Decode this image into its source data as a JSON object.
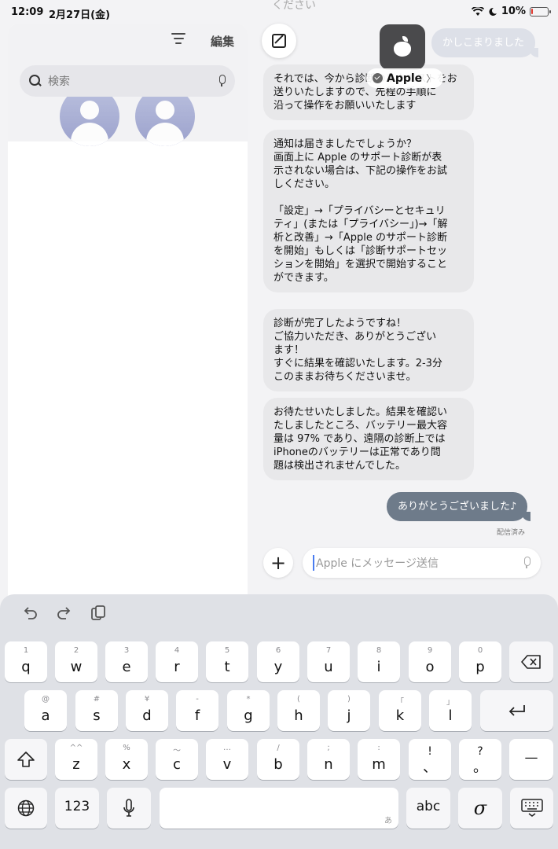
{
  "status_bar": {
    "time": "12:09",
    "date": "2月27日(金)",
    "battery": "10%",
    "battery_level_percent": 10,
    "icons": [
      "wifi-icon",
      "moon-icon",
      "battery-icon"
    ]
  },
  "sidebar": {
    "edit_label": "編集",
    "search_placeholder": "検索"
  },
  "conversation": {
    "contact_name": "Apple",
    "top_faded_text": "ください",
    "messages": [
      {
        "direction": "out",
        "text": "かしこまりました"
      },
      {
        "direction": "in",
        "text": "それでは、今から診断のリクエストをお\n送りいたしますので、先程の手順に\n沿って操作をお願いいたします"
      },
      {
        "direction": "in",
        "text": "通知は届きましたでしょうか？\n画面上に Apple のサポート診断が表\n示されない場合は、下記の操作をお試\nしください。\n\n「設定」→「プライバシーとセキュリ\nティ」(または「プライバシー」)→「解\n析と改善」→「Apple のサポート診断\nを開始」もしくは「診断サポートセッ\nションを開始」を選択で開始すること\nができます。"
      },
      {
        "direction": "in",
        "text": "診断が完了したようですね！\nご協力いただき、ありがとうござい\nます！\nすぐに結果を確認いたします。2-3分\nこのままお待ちくださいませ。"
      },
      {
        "direction": "in",
        "text": "お待たせいたしました。結果を確認い\nたしましたところ、バッテリー最大容\n量は 97% であり、遠隔の診断上では\niPhoneのバッテリーは正常であり問\n題は検出されませんでした。"
      },
      {
        "direction": "out",
        "text": "ありがとうございました♪"
      }
    ],
    "read_receipt": "配信済み",
    "composer_placeholder": "Apple にメッセージ送信"
  },
  "keyboard": {
    "row1": [
      {
        "sub": "1",
        "main": "q"
      },
      {
        "sub": "2",
        "main": "w"
      },
      {
        "sub": "3",
        "main": "e"
      },
      {
        "sub": "4",
        "main": "r"
      },
      {
        "sub": "5",
        "main": "t"
      },
      {
        "sub": "6",
        "main": "y"
      },
      {
        "sub": "7",
        "main": "u"
      },
      {
        "sub": "8",
        "main": "i"
      },
      {
        "sub": "9",
        "main": "o"
      },
      {
        "sub": "0",
        "main": "p"
      }
    ],
    "row2": [
      {
        "sub": "@",
        "main": "a"
      },
      {
        "sub": "#",
        "main": "s"
      },
      {
        "sub": "¥",
        "main": "d"
      },
      {
        "sub": "-",
        "main": "f"
      },
      {
        "sub": "*",
        "main": "g"
      },
      {
        "sub": "(",
        "main": "h"
      },
      {
        "sub": ")",
        "main": "j"
      },
      {
        "sub": "「",
        "main": "k"
      },
      {
        "sub": "」",
        "main": "l"
      }
    ],
    "row3": [
      {
        "sub": "^^",
        "main": "z"
      },
      {
        "sub": "%",
        "main": "x"
      },
      {
        "sub": "〜",
        "main": "c"
      },
      {
        "sub": "…",
        "main": "v"
      },
      {
        "sub": "/",
        "main": "b"
      },
      {
        "sub": ";",
        "main": "n"
      },
      {
        "sub": ":",
        "main": "m"
      },
      {
        "sub": "!",
        "main": "、"
      },
      {
        "sub": "?",
        "main": "。"
      }
    ],
    "dash_key": "—",
    "numbers_key": "123",
    "abc_key": "abc",
    "space_corner": "あ",
    "handwriting_key": "σ"
  },
  "colors": {
    "outgoing_bubble": "#6e7b8a",
    "incoming_bubble": "#e8e8ea",
    "caret": "#4a7cf0",
    "battery_low": "#e0342a"
  }
}
